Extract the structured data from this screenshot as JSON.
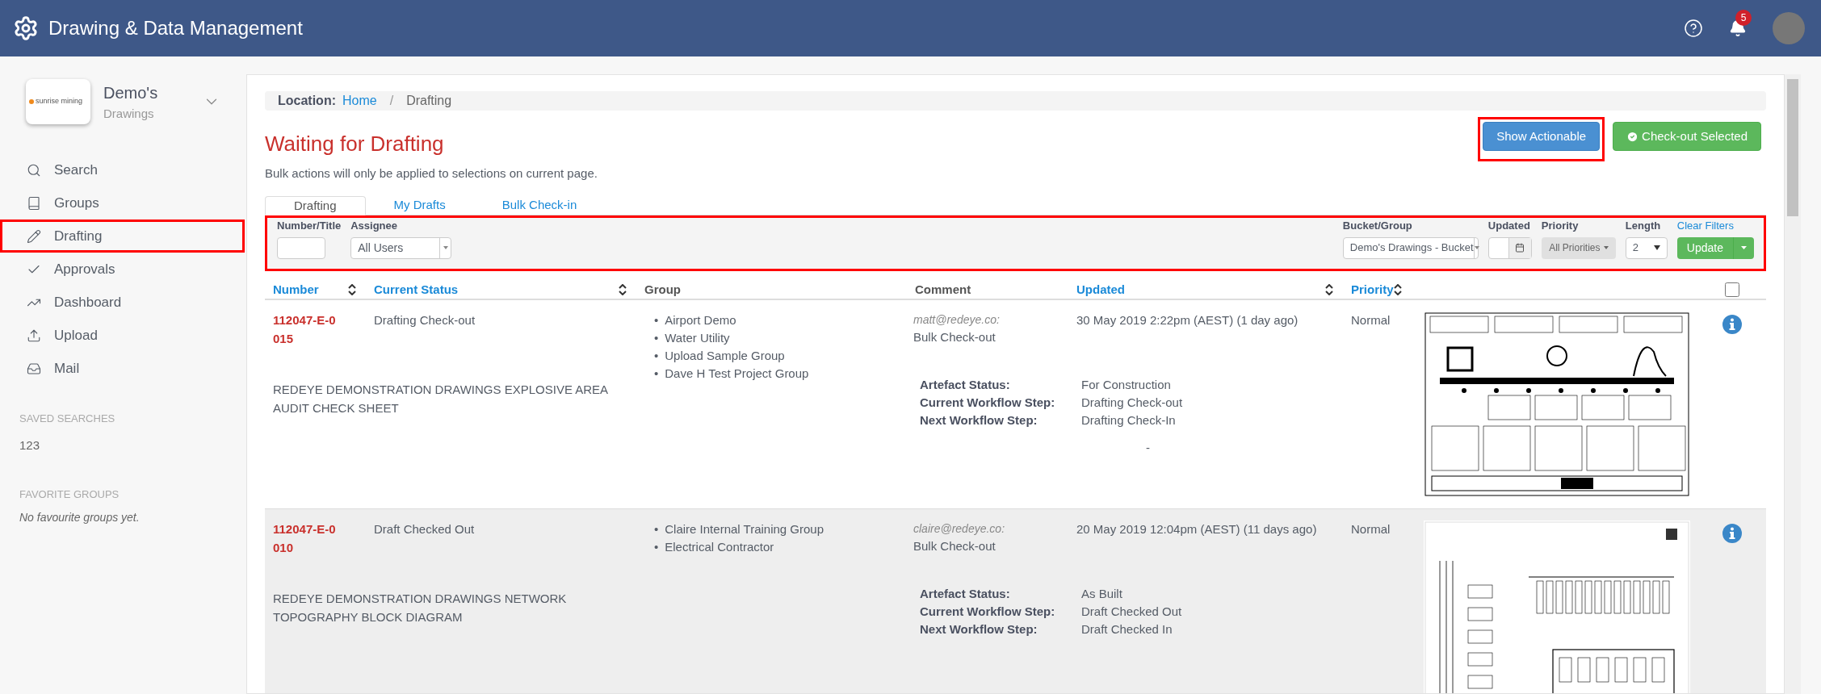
{
  "app_bar": {
    "title": "Drawing & Data Management",
    "notification_count": "5"
  },
  "sidebar": {
    "org": {
      "name": "Demo's",
      "subtitle": "Drawings",
      "logo_text": "sunrise mining"
    },
    "nav": [
      {
        "label": "Search",
        "highlighted": false
      },
      {
        "label": "Groups",
        "highlighted": false
      },
      {
        "label": "Drafting",
        "highlighted": true
      },
      {
        "label": "Approvals",
        "highlighted": false
      },
      {
        "label": "Dashboard",
        "highlighted": false
      },
      {
        "label": "Upload",
        "highlighted": false
      },
      {
        "label": "Mail",
        "highlighted": false
      }
    ],
    "saved_searches": {
      "heading": "SAVED SEARCHES",
      "items": [
        "123"
      ]
    },
    "favorite_groups": {
      "heading": "FAVORITE GROUPS",
      "empty_text": "No favourite groups yet."
    }
  },
  "breadcrumb": {
    "label": "Location:",
    "separator": "/",
    "items": [
      {
        "text": "Home",
        "link": true
      },
      {
        "text": "Drafting",
        "link": false
      }
    ]
  },
  "page": {
    "title": "Waiting for Drafting",
    "subtitle": "Bulk actions will only be applied to selections on current page."
  },
  "actions": [
    {
      "label": "Show Actionable",
      "kind": "primary",
      "highlighted": true
    },
    {
      "label": "Check-out Selected",
      "kind": "success",
      "highlighted": false
    }
  ],
  "tabs": [
    {
      "label": "Drafting",
      "selected": true
    },
    {
      "label": "My Drafts",
      "selected": false
    },
    {
      "label": "Bulk Check-in",
      "selected": false
    }
  ],
  "filters": {
    "highlighted": true,
    "number_title": {
      "label": "Number/Title"
    },
    "assignee": {
      "label": "Assignee",
      "value": "All Users"
    },
    "bucket": {
      "label": "Bucket/Group",
      "value": "Demo's Drawings - Bucket"
    },
    "updated": {
      "label": "Updated"
    },
    "priority": {
      "label": "Priority",
      "value": "All Priorities"
    },
    "length": {
      "label": "Length",
      "value": "2"
    },
    "clear": "Clear Filters",
    "update": "Update"
  },
  "table": {
    "select_all": {
      "checked": false
    },
    "group_bullet": "•",
    "columns": [
      {
        "label": "Number",
        "sortable": true
      },
      {
        "label": "Current Status",
        "sortable": true
      },
      {
        "label": "Group",
        "sortable": false
      },
      {
        "label": "Comment",
        "sortable": false
      },
      {
        "label": "Updated",
        "sortable": true
      },
      {
        "label": "Priority",
        "sortable": true
      }
    ],
    "rows": [
      {
        "number": "112047-E-0015",
        "status": "Drafting Check-out",
        "title": "REDEYE DEMONSTRATION DRAWINGS EXPLOSIVE AREA AUDIT CHECK SHEET",
        "groups": [
          "Airport Demo",
          "Water Utility",
          "Upload Sample Group",
          "Dave H Test Project Group"
        ],
        "comment_author": "matt@redeye.co:",
        "comment_text": "Bulk Check-out",
        "details": [
          {
            "label": "Artefact Status:",
            "value": "For Construction"
          },
          {
            "label": "Current Workflow Step:",
            "value": "Drafting Check-out"
          },
          {
            "label": "Next Workflow Step:",
            "value": "Drafting Check-In"
          }
        ],
        "note": "-",
        "updated": "30 May 2019 2:22pm (AEST) (1 day ago)",
        "priority": "Normal",
        "hovered": false
      },
      {
        "number": "112047-E-0010",
        "status": "Draft Checked Out",
        "title": "REDEYE DEMONSTRATION DRAWINGS NETWORK TOPOGRAPHY BLOCK DIAGRAM",
        "groups": [
          "Claire Internal Training Group",
          "Electrical Contractor"
        ],
        "comment_author": "claire@redeye.co:",
        "comment_text": "Bulk Check-out",
        "details": [
          {
            "label": "Artefact Status:",
            "value": "As Built"
          },
          {
            "label": "Current Workflow Step:",
            "value": "Draft Checked Out"
          },
          {
            "label": "Next Workflow Step:",
            "value": "Draft Checked In"
          }
        ],
        "updated": "20 May 2019 12:04pm (AEST) (11 days ago)",
        "priority": "Normal",
        "hovered": true
      }
    ]
  }
}
